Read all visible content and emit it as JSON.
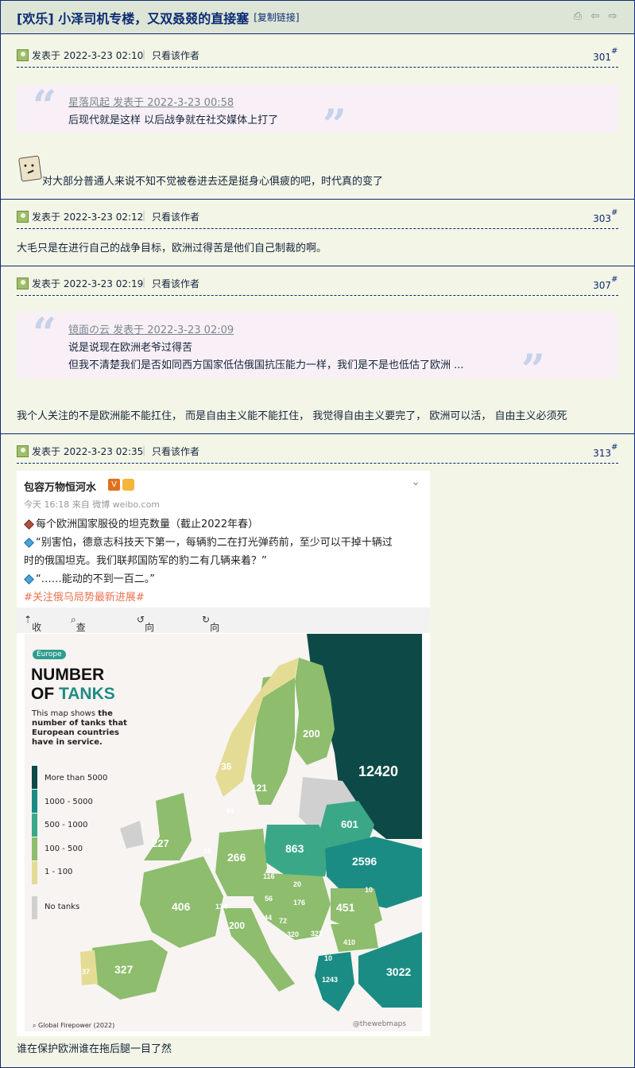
{
  "thread": {
    "title": "[欢乐] 小泽司机专楼，又双叒叕的直接塞",
    "copy_link": "[复制链接]"
  },
  "toolbar_icons": [
    "print-icon",
    "prev-arrow-icon",
    "next-arrow-icon"
  ],
  "posts": [
    {
      "date": "发表于 2022-3-23 02:10",
      "only_author": "只看该作者",
      "floor": "301",
      "floor_mark": "#",
      "quote": {
        "author": "星落风起 发表于 2022-3-23 00:58",
        "lines": [
          "后现代就是这样 以后战争就在社交媒体上打了"
        ]
      },
      "body": "对大部分普通人来说不知不觉被卷进去还是挺身心俱疲的吧，时代真的变了"
    },
    {
      "date": "发表于 2022-3-23 02:12",
      "only_author": "只看该作者",
      "floor": "303",
      "floor_mark": "#",
      "body": "大毛只是在进行自己的战争目标，欧洲过得苦是他们自己制裁的啊。"
    },
    {
      "date": "发表于 2022-3-23 02:19",
      "only_author": "只看该作者",
      "floor": "307",
      "floor_mark": "#",
      "quote": {
        "author": "镜面の云 发表于 2022-3-23 02:09",
        "lines": [
          "说是说现在欧洲老爷过得苦",
          "但我不清楚我们是否如同西方国家低估俄国抗压能力一样，我们是不是也低估了欧洲 ..."
        ]
      },
      "body": "我个人关注的不是欧洲能不能扛住， 而是自由主义能不能扛住， 我觉得自由主义要完了， 欧洲可以活， 自由主义必须死"
    },
    {
      "date": "发表于 2022-3-23 02:35",
      "only_author": "只看该作者",
      "floor": "313",
      "floor_mark": "#",
      "weibo": {
        "name": "包容万物恒河水",
        "v_badge": "V",
        "meta": "今天 16:18 来自 微博 weibo.com",
        "line1": "每个欧洲国家服役的坦克数量（截止2022年春）",
        "line2": "“别害怕，德意志科技天下第一，每辆豹二在打光弹药前，至少可以干掉十辆过",
        "line3": "时的俄国坦克。我们联邦国防军的豹二有几辆来着？”",
        "line4": "“……能动的不到一百二。”",
        "tag": "#关注俄乌局势最新进展#",
        "tools": [
          "收起",
          "查看大图",
          "向左旋转",
          "向右旋转"
        ],
        "map": {
          "tag": "Europe",
          "title1": "NUMBER",
          "title2a": "OF ",
          "title2b": "TANKS",
          "desc_a": "This map shows ",
          "desc_b": "the number of tanks that European countries have in service.",
          "legend": [
            {
              "label": "More than 5000",
              "color": "#0d4a47"
            },
            {
              "label": "1000 - 5000",
              "color": "#1a8c84"
            },
            {
              "label": "500 - 1000",
              "color": "#3aa886"
            },
            {
              "label": "100 - 500",
              "color": "#8dbd6d"
            },
            {
              "label": "1 - 100",
              "color": "#e4dc95"
            },
            {
              "label": "No tanks",
              "color": "#d0d0d0"
            }
          ],
          "values": {
            "russia": "12420",
            "finland": "200",
            "norway": "36",
            "sweden": "121",
            "estonia": "44",
            "lithuania": "601",
            "belarus": "601",
            "poland": "863",
            "ukraine": "2596",
            "uk": "227",
            "netherlands": "18",
            "germany": "266",
            "czechia": "116",
            "slovakia": "20",
            "france": "406",
            "switzerland": "134",
            "austria": "56",
            "hungary": "176",
            "romania": "451",
            "moldova": "10",
            "slovenia": "44",
            "croatia": "72",
            "serbia": "320",
            "bulgaria": "410",
            "bosnia": "323",
            "italy": "200",
            "macedonia": "10",
            "greece": "1243",
            "turkey": "3022",
            "spain": "327",
            "portugal": "37"
          },
          "source": "Global Firepower (2022)",
          "watermark": "thewebmaps"
        }
      },
      "body": "谁在保护欧洲谁在拖后腿一目了然"
    }
  ]
}
